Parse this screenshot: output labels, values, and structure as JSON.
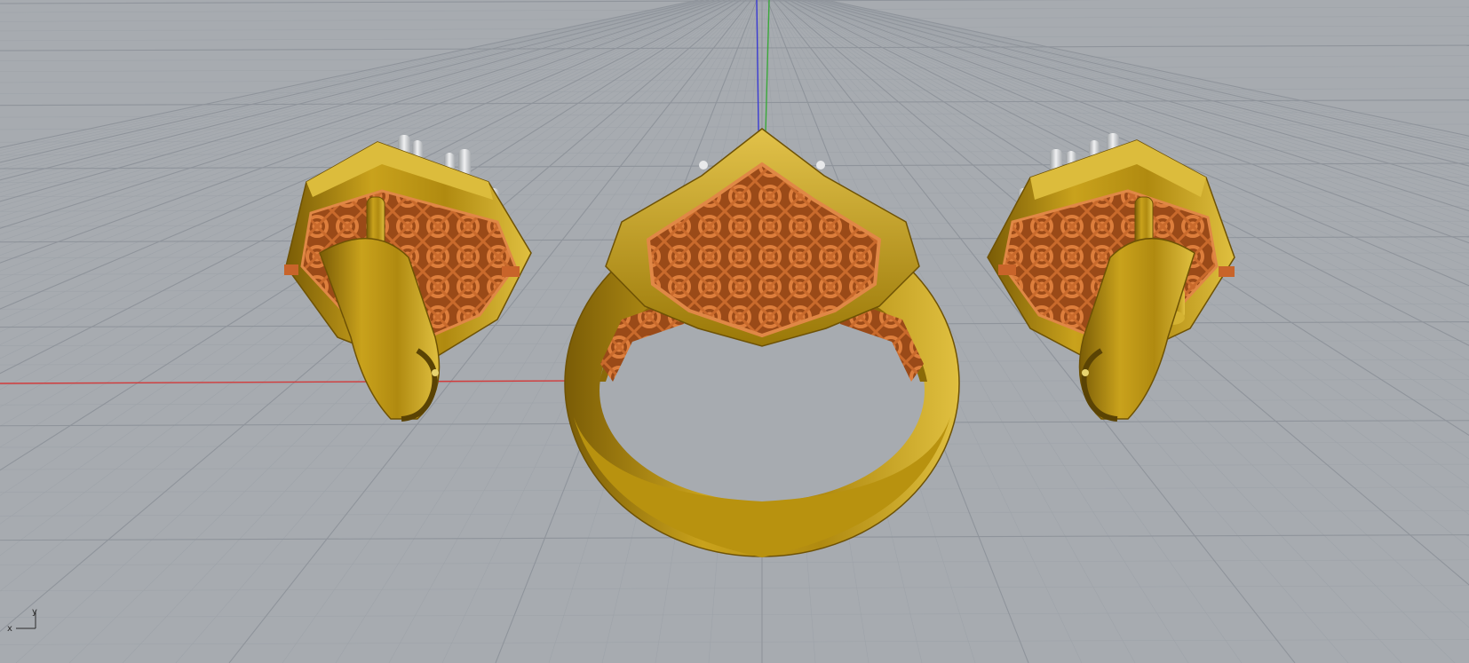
{
  "viewport": {
    "name": "Perspective",
    "background_color": "#a7abb0",
    "grid_minor_color": "#9ea3a9",
    "grid_major_color": "#8f949b",
    "x_axis_color": "#d23a3a",
    "y_axis_color": "#3aa83a",
    "z_axis_color": "#3a3ad2"
  },
  "materials": {
    "gold": "#c9a21c",
    "gold_dark": "#8a6a08",
    "gold_light": "#e2c24a",
    "copper": "#c8642a",
    "copper_dark": "#8e3f14",
    "silver": "#d8dadc"
  },
  "objects": [
    {
      "name": "earring-left"
    },
    {
      "name": "ring-center"
    },
    {
      "name": "earring-right"
    }
  ],
  "axis_widget": {
    "x_label": "x",
    "y_label": "y"
  }
}
